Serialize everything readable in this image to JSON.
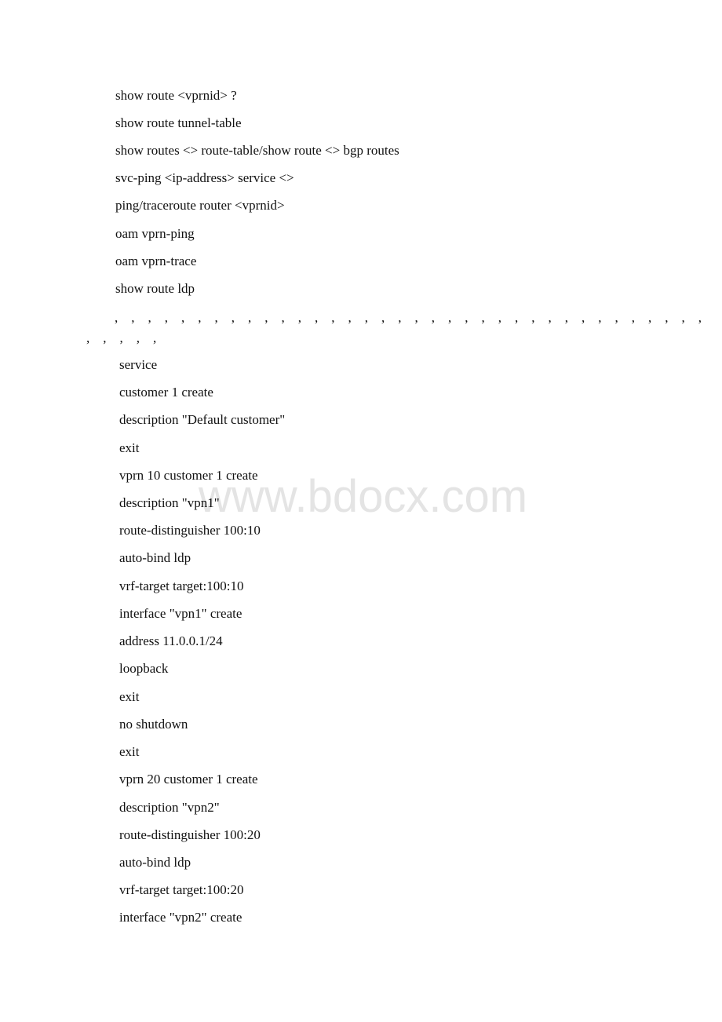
{
  "document": {
    "watermark": "www.bdocx.com",
    "commands": [
      "show route <vprnid> ?",
      "show route tunnel-table",
      "show routes <> route-table/show route <> bgp routes",
      "svc-ping <ip-address> service <>",
      "ping/traceroute router <vprnid>",
      "oam vprn-ping",
      "oam vprn-trace",
      "show route ldp"
    ],
    "comma_row_1": ",    ,    ,    ,    ,    ,    ,    ,    ,    ,    ,    ,    ,    ,    ,    ,    ,    ,    ,    ,    ,    ,    ,    ,    ,    ,    ,    ,    ,    ,    ,    ,    ,    ,    ,    ,",
    "comma_row_2": ",    ,    ,    ,    ,",
    "config": [
      "service",
      "customer 1 create",
      "description \"Default customer\"",
      "exit",
      "vprn 10 customer 1 create",
      "description \"vpn1\"",
      "route-distinguisher 100:10",
      "auto-bind ldp",
      "vrf-target target:100:10",
      "interface \"vpn1\" create",
      "address 11.0.0.1/24",
      "loopback",
      "exit",
      "no shutdown",
      "exit",
      "vprn 20 customer 1 create",
      "description \"vpn2\"",
      "route-distinguisher 100:20",
      "auto-bind ldp",
      "vrf-target target:100:20",
      "interface \"vpn2\" create"
    ]
  }
}
